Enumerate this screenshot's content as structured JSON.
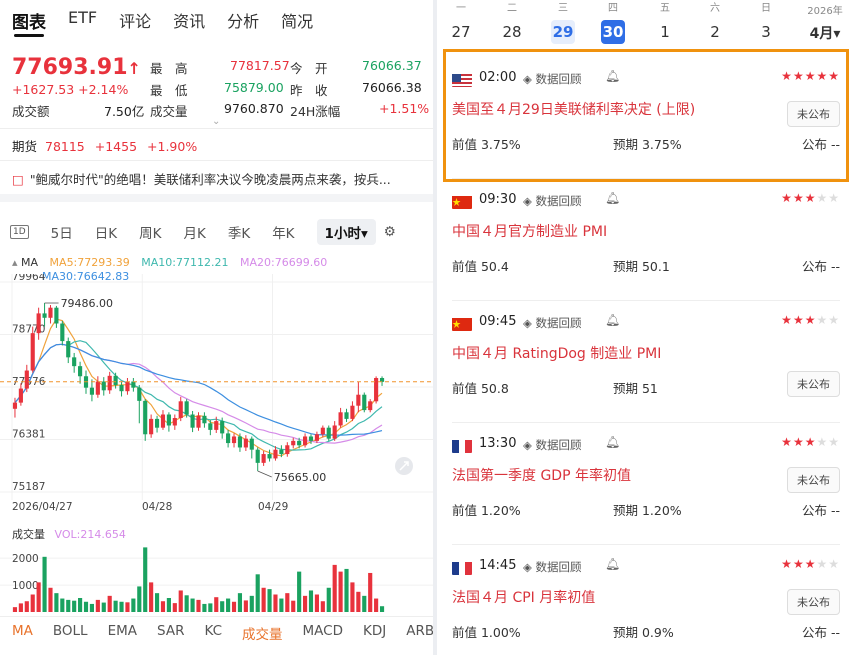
{
  "left": {
    "nav_tabs": [
      "图表",
      "ETF",
      "评论",
      "资讯",
      "分析",
      "简况"
    ],
    "price": "77693.91",
    "price_arrow": "↑",
    "change": "+1627.53 +2.14%",
    "turnover_label": "成交额",
    "turnover_value": "7.50亿",
    "high_label": "最　高",
    "high_value": "77817.57",
    "low_label": "最　低",
    "low_value": "75879.00",
    "volume_label": "成交量",
    "volume_value": "9760.870",
    "open_label": "今　开",
    "open_value": "76066.37",
    "prevclose_label": "昨　收",
    "prevclose_value": "76066.38",
    "change24_label": "24H涨幅",
    "change24_value": "+1.51%",
    "futures_label": "期货",
    "futures_value": "78115",
    "futures_change": "+1455",
    "futures_pct": "+1.90%",
    "news_text": "\"鲍威尔时代\"的绝唱！美联储利率决议今晚凌晨两点来袭，按兵...",
    "period_tabs": [
      "1D",
      "5日",
      "日K",
      "周K",
      "月K",
      "季K",
      "年K"
    ],
    "period_active": "1小时▾",
    "settings_icon": "gear-icon",
    "ma_label": "MA",
    "ma5": "MA5:77293.39",
    "ma10": "MA10:77112.21",
    "ma20": "MA20:76699.60",
    "ma30": "MA30:76642.83",
    "vol_label": "成交量",
    "vol_value": "VOL:214.654",
    "indicator_tabs": [
      "MA",
      "BOLL",
      "EMA",
      "SAR",
      "KC",
      "成交量",
      "MACD",
      "KDJ",
      "ARBR"
    ],
    "indicator_active": [
      "MA",
      "成交量"
    ],
    "colors": {
      "up": "#e8323c",
      "down": "#1aa260",
      "ma5": "#f0a23b",
      "ma10": "#3fb8ae",
      "ma20": "#d58be8",
      "ma30": "#3d8fe0"
    }
  },
  "chart_data": {
    "type": "candlestick",
    "y_ticks": [
      "79964",
      "78770",
      "77576",
      "76381",
      "75187"
    ],
    "x_labels": [
      "2026/04/27",
      "04/28",
      "04/29"
    ],
    "ylim": [
      75187,
      79964
    ],
    "last_price_line": 77693.91,
    "annotations": [
      {
        "label": "79486.00"
      },
      {
        "label": "75665.00"
      }
    ],
    "candles": [
      [
        77080,
        77220,
        76880,
        77330
      ],
      [
        77220,
        77540,
        77150,
        77660
      ],
      [
        77540,
        77950,
        77460,
        78080
      ],
      [
        77950,
        78800,
        77900,
        78950
      ],
      [
        78800,
        79250,
        78650,
        79380
      ],
      [
        79250,
        79150,
        78950,
        79486
      ],
      [
        79150,
        79380,
        79020,
        79440
      ],
      [
        79380,
        79020,
        78920,
        79420
      ],
      [
        79020,
        78620,
        78520,
        79080
      ],
      [
        78620,
        78250,
        78120,
        78700
      ],
      [
        78250,
        78050,
        77900,
        78350
      ],
      [
        78050,
        77820,
        77650,
        78150
      ],
      [
        77820,
        77560,
        77420,
        77950
      ],
      [
        77560,
        77400,
        77250,
        77750
      ],
      [
        77400,
        77700,
        77330,
        77820
      ],
      [
        77700,
        77500,
        77380,
        77800
      ],
      [
        77500,
        77830,
        77420,
        77920
      ],
      [
        77830,
        77620,
        77540,
        77900
      ],
      [
        77620,
        77480,
        77360,
        77700
      ],
      [
        77480,
        77700,
        77400,
        77780
      ],
      [
        77700,
        77560,
        77470,
        77780
      ],
      [
        77560,
        77260,
        76750,
        77620
      ],
      [
        77260,
        76500,
        76350,
        77300
      ],
      [
        76500,
        76850,
        76420,
        76950
      ],
      [
        76850,
        76650,
        76540,
        76920
      ],
      [
        76650,
        76950,
        76600,
        77050
      ],
      [
        76950,
        76700,
        76560,
        77000
      ],
      [
        76700,
        76870,
        76600,
        76950
      ],
      [
        76870,
        77250,
        76800,
        77350
      ],
      [
        77250,
        76950,
        76880,
        77300
      ],
      [
        76950,
        76650,
        76550,
        77030
      ],
      [
        76650,
        76920,
        76580,
        77000
      ],
      [
        76920,
        76750,
        76650,
        77000
      ],
      [
        76750,
        76600,
        76480,
        76820
      ],
      [
        76600,
        76800,
        76530,
        76900
      ],
      [
        76800,
        76520,
        76400,
        76880
      ],
      [
        76520,
        76300,
        76200,
        76600
      ],
      [
        76300,
        76450,
        76200,
        76520
      ],
      [
        76450,
        76200,
        76100,
        76520
      ],
      [
        76200,
        76400,
        76120,
        76480
      ],
      [
        76400,
        76150,
        75950,
        76450
      ],
      [
        76150,
        75850,
        75665,
        76200
      ],
      [
        75850,
        76050,
        75780,
        76120
      ],
      [
        76050,
        75950,
        75880,
        76150
      ],
      [
        75950,
        76150,
        75900,
        76230
      ],
      [
        76150,
        76050,
        75980,
        76250
      ],
      [
        76050,
        76250,
        75990,
        76320
      ],
      [
        76250,
        76350,
        76180,
        76420
      ],
      [
        76350,
        76250,
        76180,
        76420
      ],
      [
        76250,
        76450,
        76200,
        76520
      ],
      [
        76450,
        76350,
        76280,
        76500
      ],
      [
        76350,
        76500,
        76300,
        76560
      ],
      [
        76500,
        76650,
        76430,
        76700
      ],
      [
        76650,
        76400,
        76350,
        76700
      ],
      [
        76400,
        76700,
        76350,
        76800
      ],
      [
        76700,
        77000,
        76650,
        77100
      ],
      [
        77000,
        76850,
        76780,
        77080
      ],
      [
        76850,
        77150,
        76800,
        77250
      ],
      [
        77150,
        77400,
        77000,
        77700
      ],
      [
        77400,
        77050,
        77000,
        77450
      ],
      [
        77050,
        77250,
        77000,
        77300
      ],
      [
        77250,
        77780,
        77200,
        77817
      ],
      [
        77780,
        77693,
        77600,
        77817
      ]
    ],
    "volume_y_ticks": [
      "2000",
      "1000"
    ],
    "volumes": [
      180,
      320,
      400,
      650,
      1100,
      2050,
      900,
      700,
      500,
      450,
      420,
      520,
      380,
      300,
      450,
      350,
      600,
      420,
      380,
      360,
      500,
      950,
      2400,
      1100,
      700,
      400,
      520,
      330,
      800,
      620,
      500,
      450,
      300,
      320,
      550,
      400,
      500,
      380,
      700,
      430,
      600,
      1400,
      900,
      850,
      650,
      500,
      700,
      420,
      1500,
      600,
      800,
      650,
      400,
      900,
      1750,
      1500,
      1600,
      1100,
      750,
      600,
      1450,
      500,
      214.654
    ]
  },
  "right": {
    "week": [
      {
        "wd": "一",
        "dn": "27",
        "state": ""
      },
      {
        "wd": "二",
        "dn": "28",
        "state": ""
      },
      {
        "wd": "三",
        "dn": "29",
        "state": "today"
      },
      {
        "wd": "四",
        "dn": "30",
        "state": "selected"
      },
      {
        "wd": "五",
        "dn": "1",
        "state": ""
      },
      {
        "wd": "六",
        "dn": "2",
        "state": ""
      },
      {
        "wd": "日",
        "dn": "3",
        "state": ""
      }
    ],
    "year": "2026年",
    "month": "4月▾",
    "events": [
      {
        "flag": "us-flag-icon",
        "time": "02:00",
        "review": "数据回顾",
        "stars": 5,
        "title": "美国至４月29日美联储利率决定 (上限)",
        "prev": "前值 3.75%",
        "forecast": "预期 3.75%",
        "publish": "公布 --",
        "status": "未公布"
      },
      {
        "flag": "cn-flag-icon",
        "time": "09:30",
        "review": "数据回顾",
        "stars": 3,
        "title": "中国４月官方制造业 PMI",
        "prev": "前值 50.4",
        "forecast": "预期 50.1",
        "publish": "公布 --",
        "status": "未公布"
      },
      {
        "flag": "cn-flag-icon",
        "time": "09:45",
        "review": "数据回顾",
        "stars": 3,
        "title": "中国４月 RatingDog 制造业 PMI",
        "prev": "前值 50.8",
        "forecast": "预期 51",
        "publish": "公布 --",
        "status": "未公布"
      },
      {
        "flag": "fr-flag-icon",
        "time": "13:30",
        "review": "数据回顾",
        "stars": 3,
        "title": "法国第一季度 GDP 年率初值",
        "prev": "前值 1.20%",
        "forecast": "预期 1.20%",
        "publish": "公布 --",
        "status": "未公布"
      },
      {
        "flag": "fr-flag-icon",
        "time": "14:45",
        "review": "数据回顾",
        "stars": 3,
        "title": "法国４月 CPI 月率初值",
        "prev": "前值 1.00%",
        "forecast": "预期 0.9%",
        "publish": "公布 --",
        "status": "未公布"
      }
    ]
  }
}
